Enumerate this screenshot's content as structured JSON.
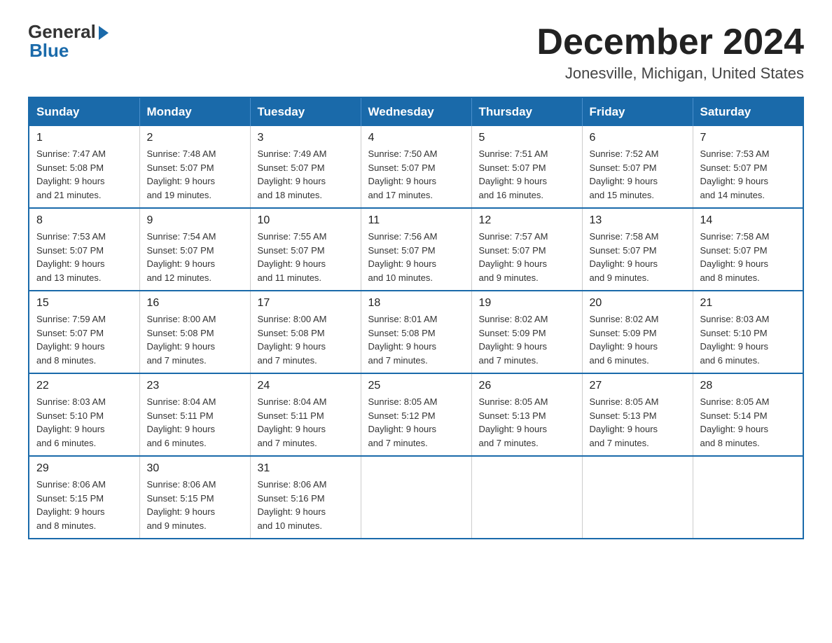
{
  "logo": {
    "general": "General",
    "blue": "Blue"
  },
  "header": {
    "month": "December 2024",
    "location": "Jonesville, Michigan, United States"
  },
  "weekdays": [
    "Sunday",
    "Monday",
    "Tuesday",
    "Wednesday",
    "Thursday",
    "Friday",
    "Saturday"
  ],
  "weeks": [
    [
      {
        "day": "1",
        "sunrise": "7:47 AM",
        "sunset": "5:08 PM",
        "daylight": "9 hours and 21 minutes."
      },
      {
        "day": "2",
        "sunrise": "7:48 AM",
        "sunset": "5:07 PM",
        "daylight": "9 hours and 19 minutes."
      },
      {
        "day": "3",
        "sunrise": "7:49 AM",
        "sunset": "5:07 PM",
        "daylight": "9 hours and 18 minutes."
      },
      {
        "day": "4",
        "sunrise": "7:50 AM",
        "sunset": "5:07 PM",
        "daylight": "9 hours and 17 minutes."
      },
      {
        "day": "5",
        "sunrise": "7:51 AM",
        "sunset": "5:07 PM",
        "daylight": "9 hours and 16 minutes."
      },
      {
        "day": "6",
        "sunrise": "7:52 AM",
        "sunset": "5:07 PM",
        "daylight": "9 hours and 15 minutes."
      },
      {
        "day": "7",
        "sunrise": "7:53 AM",
        "sunset": "5:07 PM",
        "daylight": "9 hours and 14 minutes."
      }
    ],
    [
      {
        "day": "8",
        "sunrise": "7:53 AM",
        "sunset": "5:07 PM",
        "daylight": "9 hours and 13 minutes."
      },
      {
        "day": "9",
        "sunrise": "7:54 AM",
        "sunset": "5:07 PM",
        "daylight": "9 hours and 12 minutes."
      },
      {
        "day": "10",
        "sunrise": "7:55 AM",
        "sunset": "5:07 PM",
        "daylight": "9 hours and 11 minutes."
      },
      {
        "day": "11",
        "sunrise": "7:56 AM",
        "sunset": "5:07 PM",
        "daylight": "9 hours and 10 minutes."
      },
      {
        "day": "12",
        "sunrise": "7:57 AM",
        "sunset": "5:07 PM",
        "daylight": "9 hours and 9 minutes."
      },
      {
        "day": "13",
        "sunrise": "7:58 AM",
        "sunset": "5:07 PM",
        "daylight": "9 hours and 9 minutes."
      },
      {
        "day": "14",
        "sunrise": "7:58 AM",
        "sunset": "5:07 PM",
        "daylight": "9 hours and 8 minutes."
      }
    ],
    [
      {
        "day": "15",
        "sunrise": "7:59 AM",
        "sunset": "5:07 PM",
        "daylight": "9 hours and 8 minutes."
      },
      {
        "day": "16",
        "sunrise": "8:00 AM",
        "sunset": "5:08 PM",
        "daylight": "9 hours and 7 minutes."
      },
      {
        "day": "17",
        "sunrise": "8:00 AM",
        "sunset": "5:08 PM",
        "daylight": "9 hours and 7 minutes."
      },
      {
        "day": "18",
        "sunrise": "8:01 AM",
        "sunset": "5:08 PM",
        "daylight": "9 hours and 7 minutes."
      },
      {
        "day": "19",
        "sunrise": "8:02 AM",
        "sunset": "5:09 PM",
        "daylight": "9 hours and 7 minutes."
      },
      {
        "day": "20",
        "sunrise": "8:02 AM",
        "sunset": "5:09 PM",
        "daylight": "9 hours and 6 minutes."
      },
      {
        "day": "21",
        "sunrise": "8:03 AM",
        "sunset": "5:10 PM",
        "daylight": "9 hours and 6 minutes."
      }
    ],
    [
      {
        "day": "22",
        "sunrise": "8:03 AM",
        "sunset": "5:10 PM",
        "daylight": "9 hours and 6 minutes."
      },
      {
        "day": "23",
        "sunrise": "8:04 AM",
        "sunset": "5:11 PM",
        "daylight": "9 hours and 6 minutes."
      },
      {
        "day": "24",
        "sunrise": "8:04 AM",
        "sunset": "5:11 PM",
        "daylight": "9 hours and 7 minutes."
      },
      {
        "day": "25",
        "sunrise": "8:05 AM",
        "sunset": "5:12 PM",
        "daylight": "9 hours and 7 minutes."
      },
      {
        "day": "26",
        "sunrise": "8:05 AM",
        "sunset": "5:13 PM",
        "daylight": "9 hours and 7 minutes."
      },
      {
        "day": "27",
        "sunrise": "8:05 AM",
        "sunset": "5:13 PM",
        "daylight": "9 hours and 7 minutes."
      },
      {
        "day": "28",
        "sunrise": "8:05 AM",
        "sunset": "5:14 PM",
        "daylight": "9 hours and 8 minutes."
      }
    ],
    [
      {
        "day": "29",
        "sunrise": "8:06 AM",
        "sunset": "5:15 PM",
        "daylight": "9 hours and 8 minutes."
      },
      {
        "day": "30",
        "sunrise": "8:06 AM",
        "sunset": "5:15 PM",
        "daylight": "9 hours and 9 minutes."
      },
      {
        "day": "31",
        "sunrise": "8:06 AM",
        "sunset": "5:16 PM",
        "daylight": "9 hours and 10 minutes."
      },
      null,
      null,
      null,
      null
    ]
  ],
  "labels": {
    "sunrise": "Sunrise:",
    "sunset": "Sunset:",
    "daylight": "Daylight:"
  }
}
